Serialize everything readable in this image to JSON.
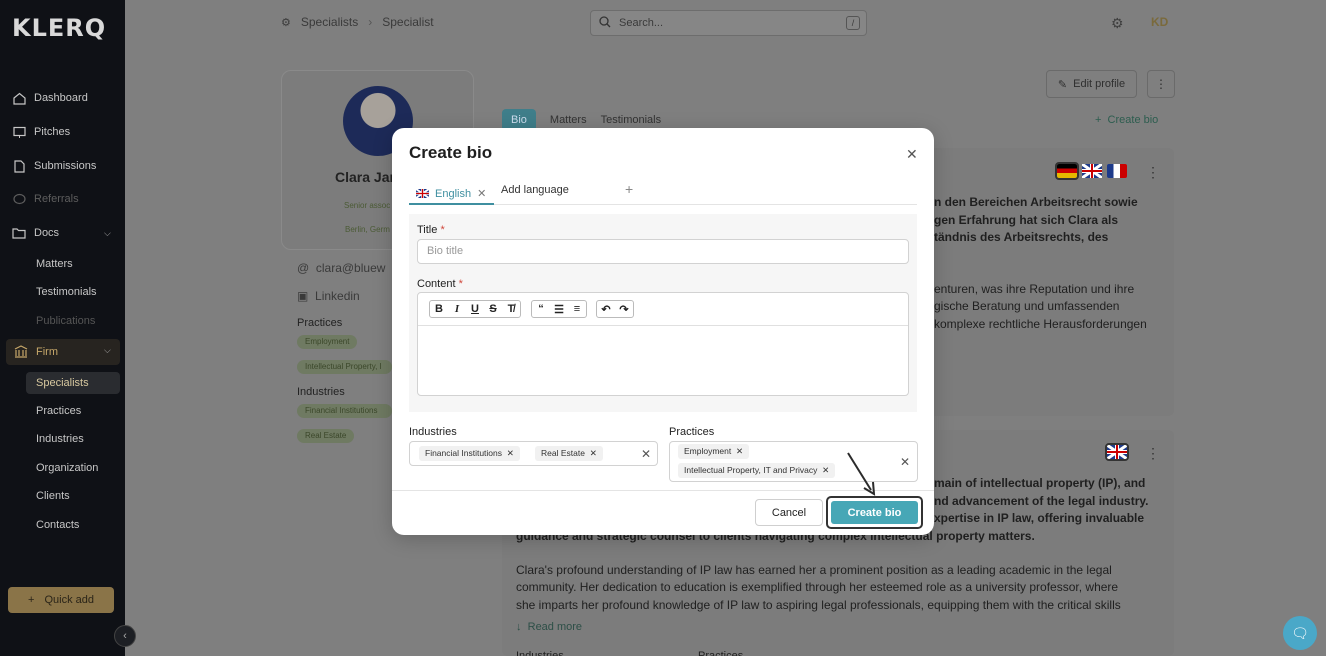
{
  "sidebar": {
    "logo": "KLERQ",
    "items": [
      {
        "label": "Dashboard"
      },
      {
        "label": "Pitches"
      },
      {
        "label": "Submissions"
      },
      {
        "label": "Referrals"
      },
      {
        "label": "Docs"
      }
    ],
    "docs_sub": [
      "Matters",
      "Testimonials",
      "Publications"
    ],
    "firm_label": "Firm",
    "firm_sub": [
      "Specialists",
      "Practices",
      "Industries",
      "Organization",
      "Clients",
      "Contacts"
    ],
    "quick_add": "Quick add"
  },
  "topbar": {
    "breadcrumb": [
      "Specialists",
      "Specialist"
    ],
    "search_placeholder": "Search...",
    "search_shortcut": "/",
    "user_initials": "KD"
  },
  "profile": {
    "name": "Clara Jar",
    "role": "Senior assoc",
    "location": "Berlin, Germ",
    "email": "clara@bluew",
    "linkedin": "Linkedin",
    "practices_heading": "Practices",
    "practices": [
      "Employment",
      "Intellectual Property, I"
    ],
    "industries_heading": "Industries",
    "industries": [
      "Financial Institutions",
      "Real Estate"
    ]
  },
  "page_tabs": [
    "Bio",
    "Matters",
    "Testimonials"
  ],
  "edit_profile": "Edit profile",
  "create_bio_link": "Create bio",
  "bio_text": {
    "de_lines_bold": [
      "n den Bereichen Arbeitsrecht sowie",
      "gen Erfahrung hat sich Clara als",
      "tändnis des Arbeitsrechts, des"
    ],
    "de_lines": [
      "enturen, was ihre Reputation und ihre",
      "gische Beratung und umfassenden",
      "komplexe rechtliche Herausforderungen"
    ],
    "en_lines_bold": [
      "main of intellectual property (IP), and",
      "nd advancement of the legal industry.",
      "xpertise in IP law, offering invaluable",
      "guidance and strategic counsel to clients navigating complex intellectual property matters."
    ],
    "en_lines": [
      "Clara's profound understanding of IP law has earned her a prominent position as a leading academic in the legal",
      "community. Her dedication to education is exemplified through her esteemed role as a university professor, where",
      "she imparts her profound knowledge of IP law to aspiring legal professionals, equipping them with the critical skills"
    ],
    "read_more": "Read more",
    "footer_labels": [
      "Industries",
      "Practices"
    ]
  },
  "modal": {
    "title": "Create bio",
    "tab_english": "English",
    "tab_add": "Add language",
    "title_label": "Title",
    "title_placeholder": "Bio title",
    "content_label": "Content",
    "industries_label": "Industries",
    "industries_tags": [
      "Financial Institutions",
      "Real Estate"
    ],
    "practices_label": "Practices",
    "practices_tags": [
      "Employment",
      "Intellectual Property, IT and Privacy"
    ],
    "cancel": "Cancel",
    "create": "Create bio"
  },
  "colors": {
    "accent": "#47a7b6",
    "gold": "#8a7448",
    "sidebar_bg": "#0f1116"
  }
}
